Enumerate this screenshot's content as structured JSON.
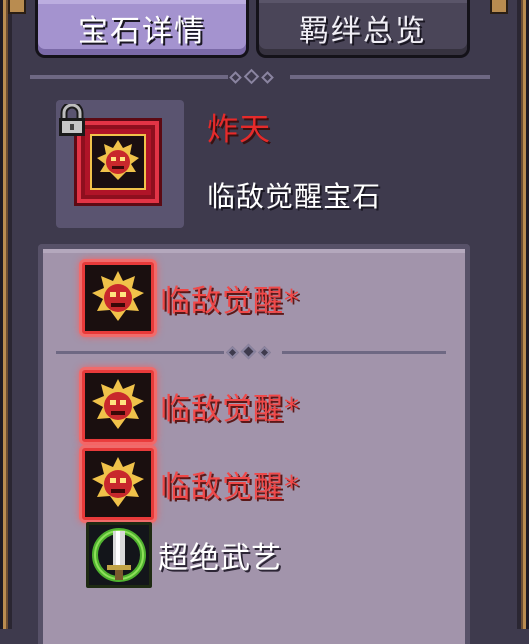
{
  "tabs": [
    {
      "label": "宝石详情",
      "active": true
    },
    {
      "label": "羁绊总览",
      "active": false
    }
  ],
  "gem": {
    "name": "炸天",
    "type": "临敌觉醒宝石",
    "locked": true,
    "name_color": "#e62a2a"
  },
  "skills_top": [
    {
      "label": "临敌觉醒*",
      "icon": "demon-mask-icon",
      "color": "#f04848"
    }
  ],
  "skills_bottom": [
    {
      "label": "临敌觉醒*",
      "icon": "demon-mask-icon",
      "color": "#f04848"
    },
    {
      "label": "临敌觉醒*",
      "icon": "demon-mask-icon",
      "color": "#f04848"
    },
    {
      "label": "超绝武艺",
      "icon": "sword-icon",
      "color": "#ffffff"
    }
  ]
}
